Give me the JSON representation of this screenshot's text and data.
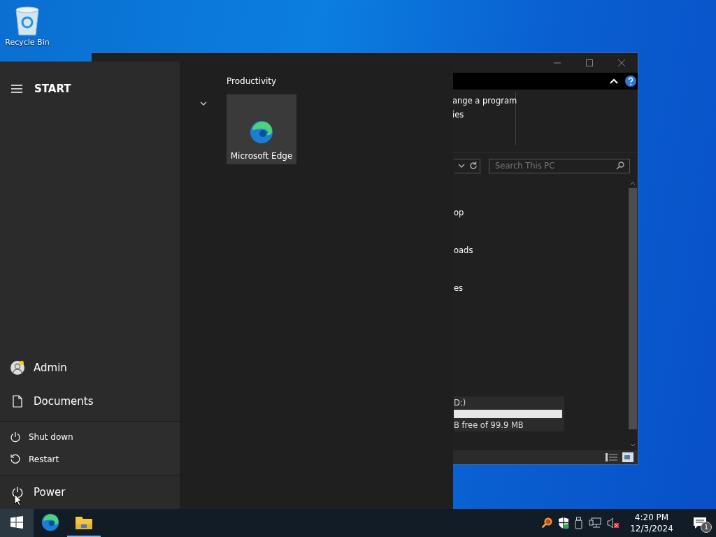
{
  "desktop": {
    "icons": [
      {
        "label": "Recycle Bin"
      }
    ]
  },
  "explorer_window": {
    "ribbon_items": [
      "ange a program",
      "ies"
    ],
    "search": {
      "placeholder": "Search This PC"
    },
    "nav_items": [
      "op",
      "oads",
      "es"
    ],
    "drive": {
      "name": "D:)",
      "free": "B free of 99.9 MB"
    }
  },
  "start_menu": {
    "title": "START",
    "group": {
      "header": "Productivity",
      "tiles": [
        {
          "label": "Microsoft Edge"
        }
      ]
    },
    "items": [
      {
        "label": "Admin",
        "kind": "user"
      },
      {
        "label": "Documents",
        "kind": "document"
      }
    ],
    "power_menu": [
      {
        "label": "Shut down",
        "kind": "shutdown"
      },
      {
        "label": "Restart",
        "kind": "restart"
      }
    ],
    "power": {
      "label": "Power"
    }
  },
  "taskbar": {
    "apps": [
      {
        "kind": "start",
        "selected": true
      },
      {
        "kind": "edge",
        "running": false
      },
      {
        "kind": "explorer",
        "running": true
      }
    ],
    "clock": {
      "time": "4:20 PM",
      "date": "12/3/2024"
    },
    "notifications": {
      "count": "1"
    }
  }
}
